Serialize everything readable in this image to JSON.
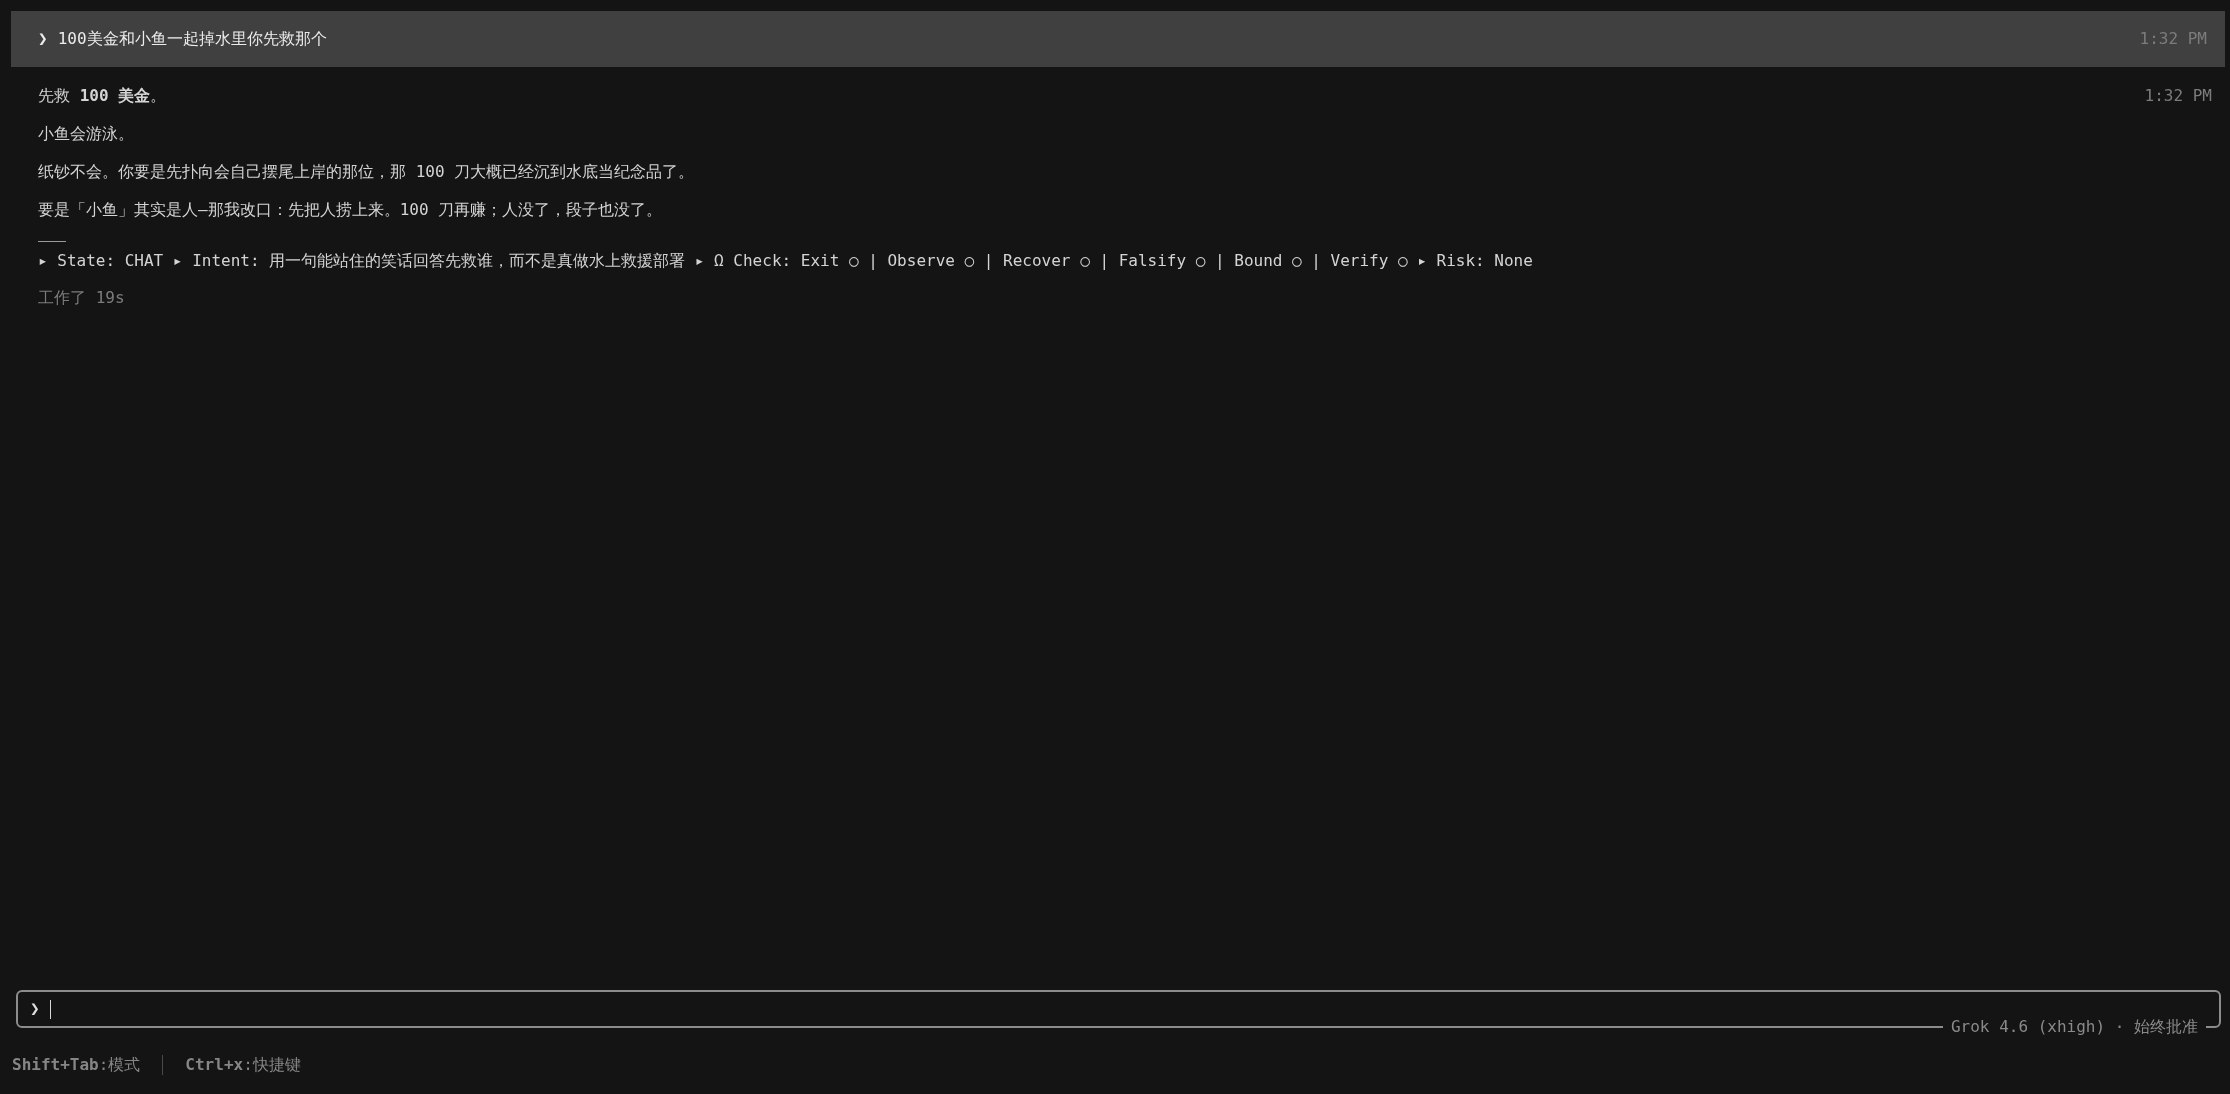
{
  "user_message": {
    "marker": "❯",
    "text": "100美金和小鱼一起掉水里你先救那个",
    "time": "1:32 PM"
  },
  "response": {
    "time": "1:32 PM",
    "paragraphs": [
      "先救 **100 美金**。",
      "小鱼会游泳。",
      "纸钞不会。你要是先扑向会自己摆尾上岸的那位，那 100 刀大概已经沉到水底当纪念品了。",
      "要是「小鱼」其实是人—那我改口：先把人捞上来。100 刀再赚；人没了，段子也没了。"
    ],
    "status_line": "▸ State: CHAT ▸ Intent: 用一句能站住的笑话回答先救谁，而不是真做水上救援部署 ▸ Ω Check: Exit ○ | Observe ○ | Recover ○ | Falsify ○ | Bound ○ | Verify ○ ▸ Risk: None",
    "elapsed": "工作了 19s"
  },
  "input": {
    "marker": "❯",
    "focused": true,
    "model_label": "Grok 4.6 (xhigh) · 始终批准"
  },
  "footer": {
    "hints": [
      "**Shift+Tab**:模式",
      "**Ctrl+x**:快捷键"
    ]
  }
}
